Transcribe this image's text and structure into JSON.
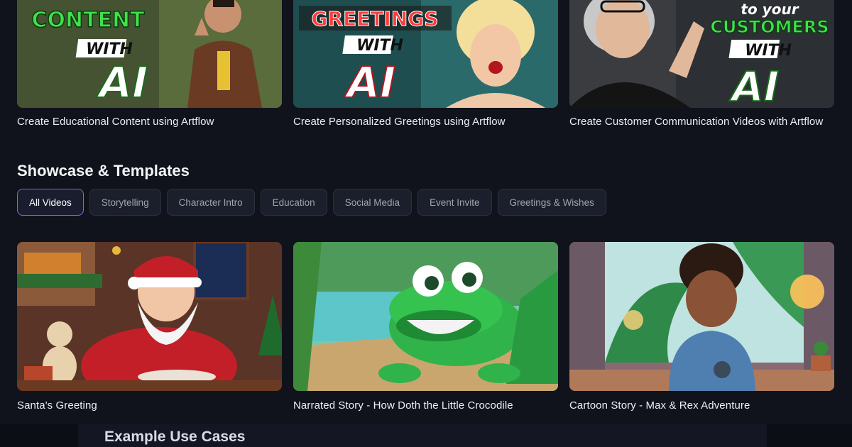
{
  "top_cards": [
    {
      "title": "Create Educational Content using Artflow",
      "thumb_line1": "CONTENT",
      "thumb_with": "WITH",
      "thumb_ai": "AI"
    },
    {
      "title": "Create Personalized Greetings using Artflow",
      "thumb_line1": "GREETINGS",
      "thumb_with": "WITH",
      "thumb_ai": "AI"
    },
    {
      "title": "Create Customer Communication Videos with Artflow",
      "thumb_line0": "to your",
      "thumb_line1": "CUSTOMERS",
      "thumb_with": "WITH",
      "thumb_ai": "AI"
    }
  ],
  "showcase": {
    "title": "Showcase & Templates",
    "filters": [
      "All Videos",
      "Storytelling",
      "Character Intro",
      "Education",
      "Social Media",
      "Event Invite",
      "Greetings & Wishes"
    ],
    "active_filter": "All Videos"
  },
  "showcase_cards": [
    {
      "title": "Santa's Greeting"
    },
    {
      "title": "Narrated Story - How Doth the Little Crocodile"
    },
    {
      "title": "Cartoon Story - Max & Rex Adventure"
    }
  ],
  "footer": {
    "title": "Example Use Cases"
  }
}
